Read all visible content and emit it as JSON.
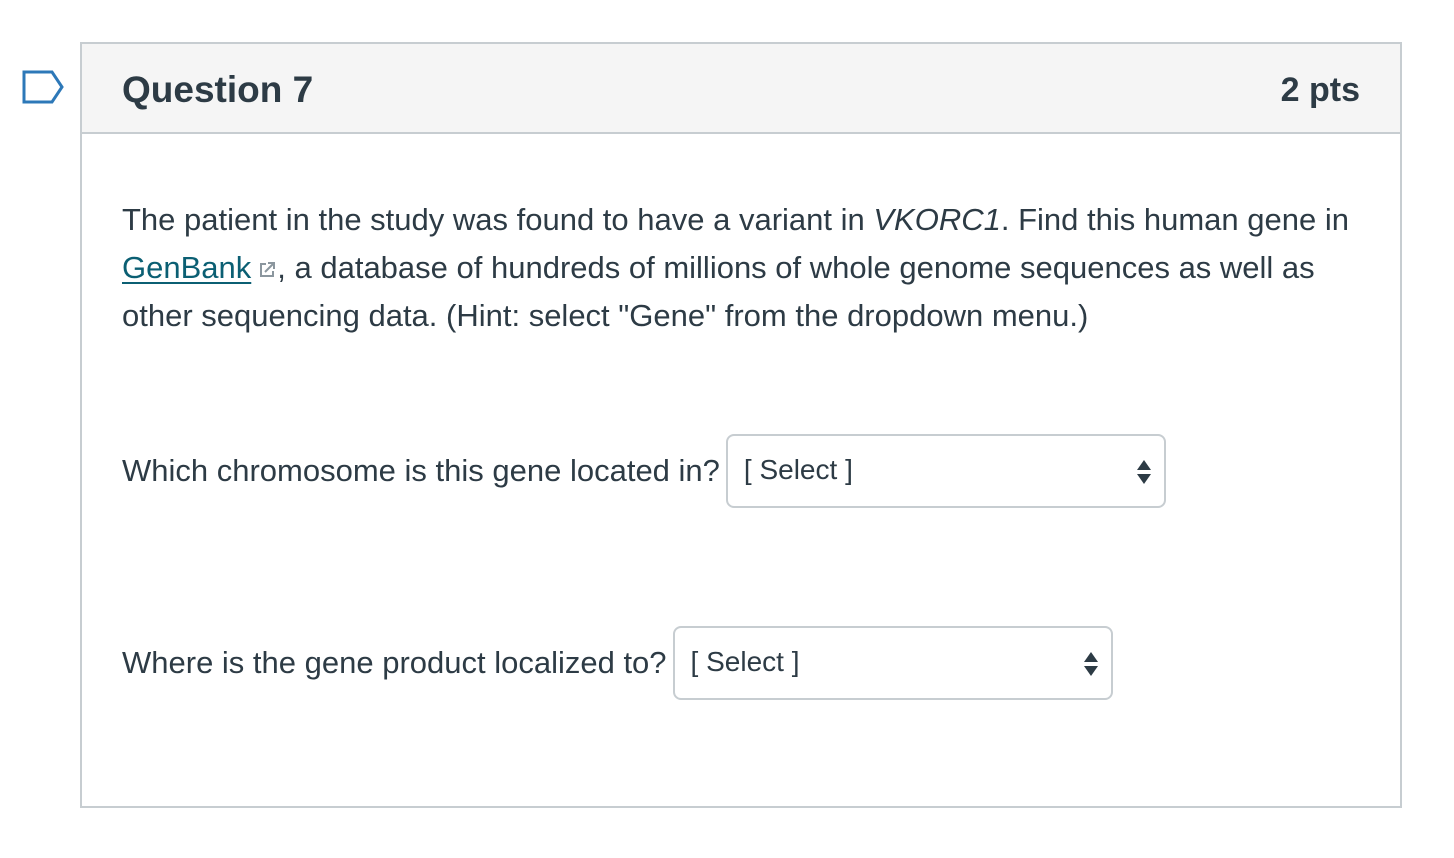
{
  "question": {
    "title": "Question 7",
    "points": "2 pts",
    "prompt_before_italic": "The patient in the study was found to have a variant in ",
    "prompt_italic": "VKORC1",
    "prompt_after_italic": ".  Find this human gene in ",
    "link_text": "GenBank",
    "prompt_after_link": ", a database of hundreds of millions of whole genome sequences as well as other sequencing data. (Hint: select \"Gene\" from the dropdown menu.)",
    "items": [
      {
        "label": "Which chromosome is this gene located in?",
        "selected": "[ Select ]"
      },
      {
        "label": "Where is the gene product localized to?",
        "selected": "[ Select ]"
      }
    ]
  },
  "icons": {
    "flag": "bookmark-flag-icon",
    "external_link": "external-link-icon",
    "select_arrows": "up-down-arrows-icon"
  },
  "colors": {
    "text": "#2d3b45",
    "link": "#0b5f73",
    "border": "#c7cdd1",
    "header_bg": "#f5f5f5",
    "flag": "#2d78b8"
  }
}
